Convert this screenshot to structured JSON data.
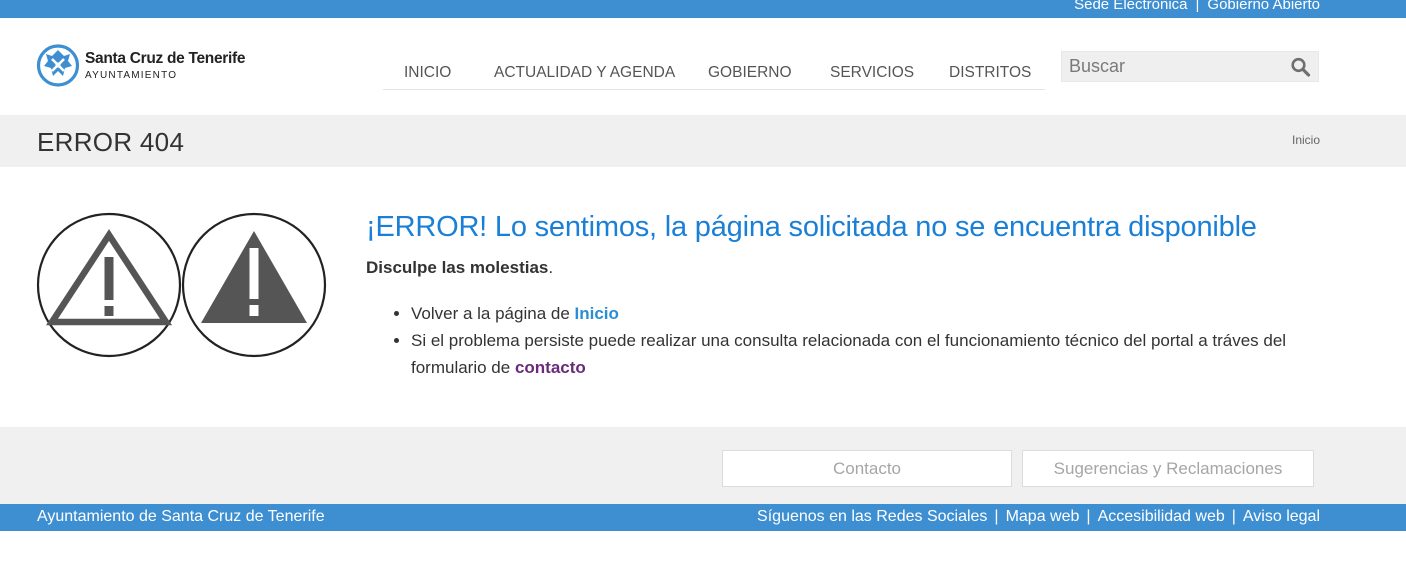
{
  "topbar": {
    "link1": "Sede Electrónica",
    "separator": "|",
    "link2": "Gobierno Abierto"
  },
  "logo": {
    "icon": "city-crest-icon",
    "title": "Santa Cruz de Tenerife",
    "subtitle": "AYUNTAMIENTO"
  },
  "nav": {
    "items": [
      "INICIO",
      "ACTUALIDAD Y AGENDA",
      "GOBIERNO",
      "SERVICIOS",
      "DISTRITOS"
    ]
  },
  "search": {
    "placeholder": "Buscar",
    "icon": "search-icon"
  },
  "title_band": {
    "title": "ERROR 404",
    "breadcrumb": "Inicio"
  },
  "main": {
    "icons": [
      "warning-outline-icon",
      "warning-filled-icon"
    ],
    "heading": "¡ERROR! Lo sentimos, la página solicitada no se encuentra disponible",
    "apology_bold": "Disculpe las molestias",
    "apology_tail": ".",
    "item1_text": "Volver a la página de ",
    "item1_link": "Inicio",
    "item2_text": "Si el problema persiste puede realizar una consulta relacionada con el funcionamiento técnico del portal a tráves del formulario de ",
    "item2_link": "contacto"
  },
  "footer_buttons": {
    "contact": "Contacto",
    "suggestions": "Sugerencias y Reclamaciones"
  },
  "footer": {
    "left": "Ayuntamiento de Santa Cruz de Tenerife",
    "links": [
      "Síguenos en las Redes Sociales",
      "Mapa web",
      "Accesibilidad web",
      "Aviso legal"
    ],
    "separator": "|"
  },
  "colors": {
    "brand_blue": "#3d8fd1",
    "heading_blue": "#1a7fd6",
    "link_blue": "#2a8ed3",
    "visited_purple": "#6a2b7c",
    "band_gray": "#f0f0f0"
  }
}
